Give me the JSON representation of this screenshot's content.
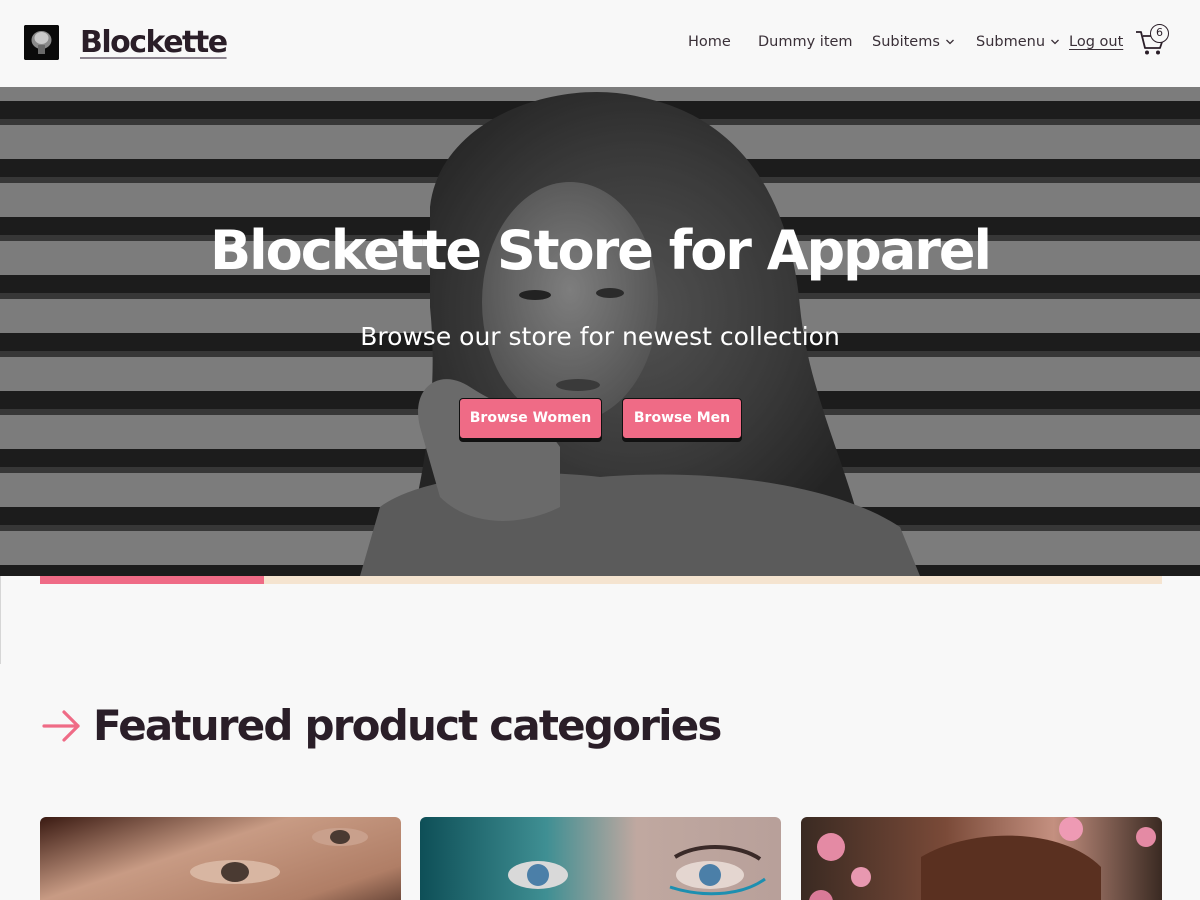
{
  "site": {
    "title": "Blockette"
  },
  "nav": {
    "items": [
      {
        "label": "Home"
      },
      {
        "label": "Dummy item"
      },
      {
        "label": "Subitems"
      },
      {
        "label": "Submenu"
      },
      {
        "label": "Log out"
      }
    ],
    "cart_count": "6"
  },
  "hero": {
    "title": "Blockette Store for Apparel",
    "subtitle": "Browse our store for newest collection",
    "buttons": [
      {
        "label": "Browse Women"
      },
      {
        "label": "Browse Men"
      }
    ],
    "slider_progress": 0.2
  },
  "section": {
    "title": "Featured product categories"
  },
  "colors": {
    "accent": "#ef6b86",
    "text": "#2a1e28",
    "track": "#f5e4d0",
    "background": "#f8f8f8"
  },
  "icons": [
    "site-logo",
    "chevron-down-icon",
    "cart-icon",
    "arrow-right-icon"
  ]
}
